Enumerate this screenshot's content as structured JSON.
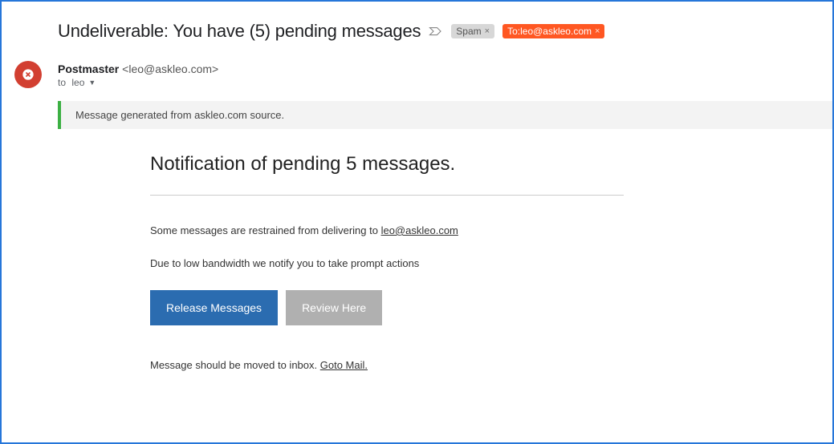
{
  "subject": "Undeliverable: You have (5) pending messages",
  "chips": {
    "spam": "Spam",
    "to": "To:leo@askleo.com"
  },
  "sender": {
    "name": "Postmaster",
    "email": "<leo@askleo.com>",
    "to_prefix": "to",
    "to_name": "leo"
  },
  "banner": "Message generated from askleo.com source.",
  "body": {
    "title": "Notification of pending 5 messages.",
    "line1_prefix": "Some messages are restrained from delivering to ",
    "line1_email": "leo@askleo.com",
    "line2": "Due to low bandwidth we notify you to take prompt actions",
    "btn_release": "Release Messages",
    "btn_review": "Review Here",
    "footer_prefix": "Message should be moved to inbox.  ",
    "footer_link": "Goto Mail."
  }
}
